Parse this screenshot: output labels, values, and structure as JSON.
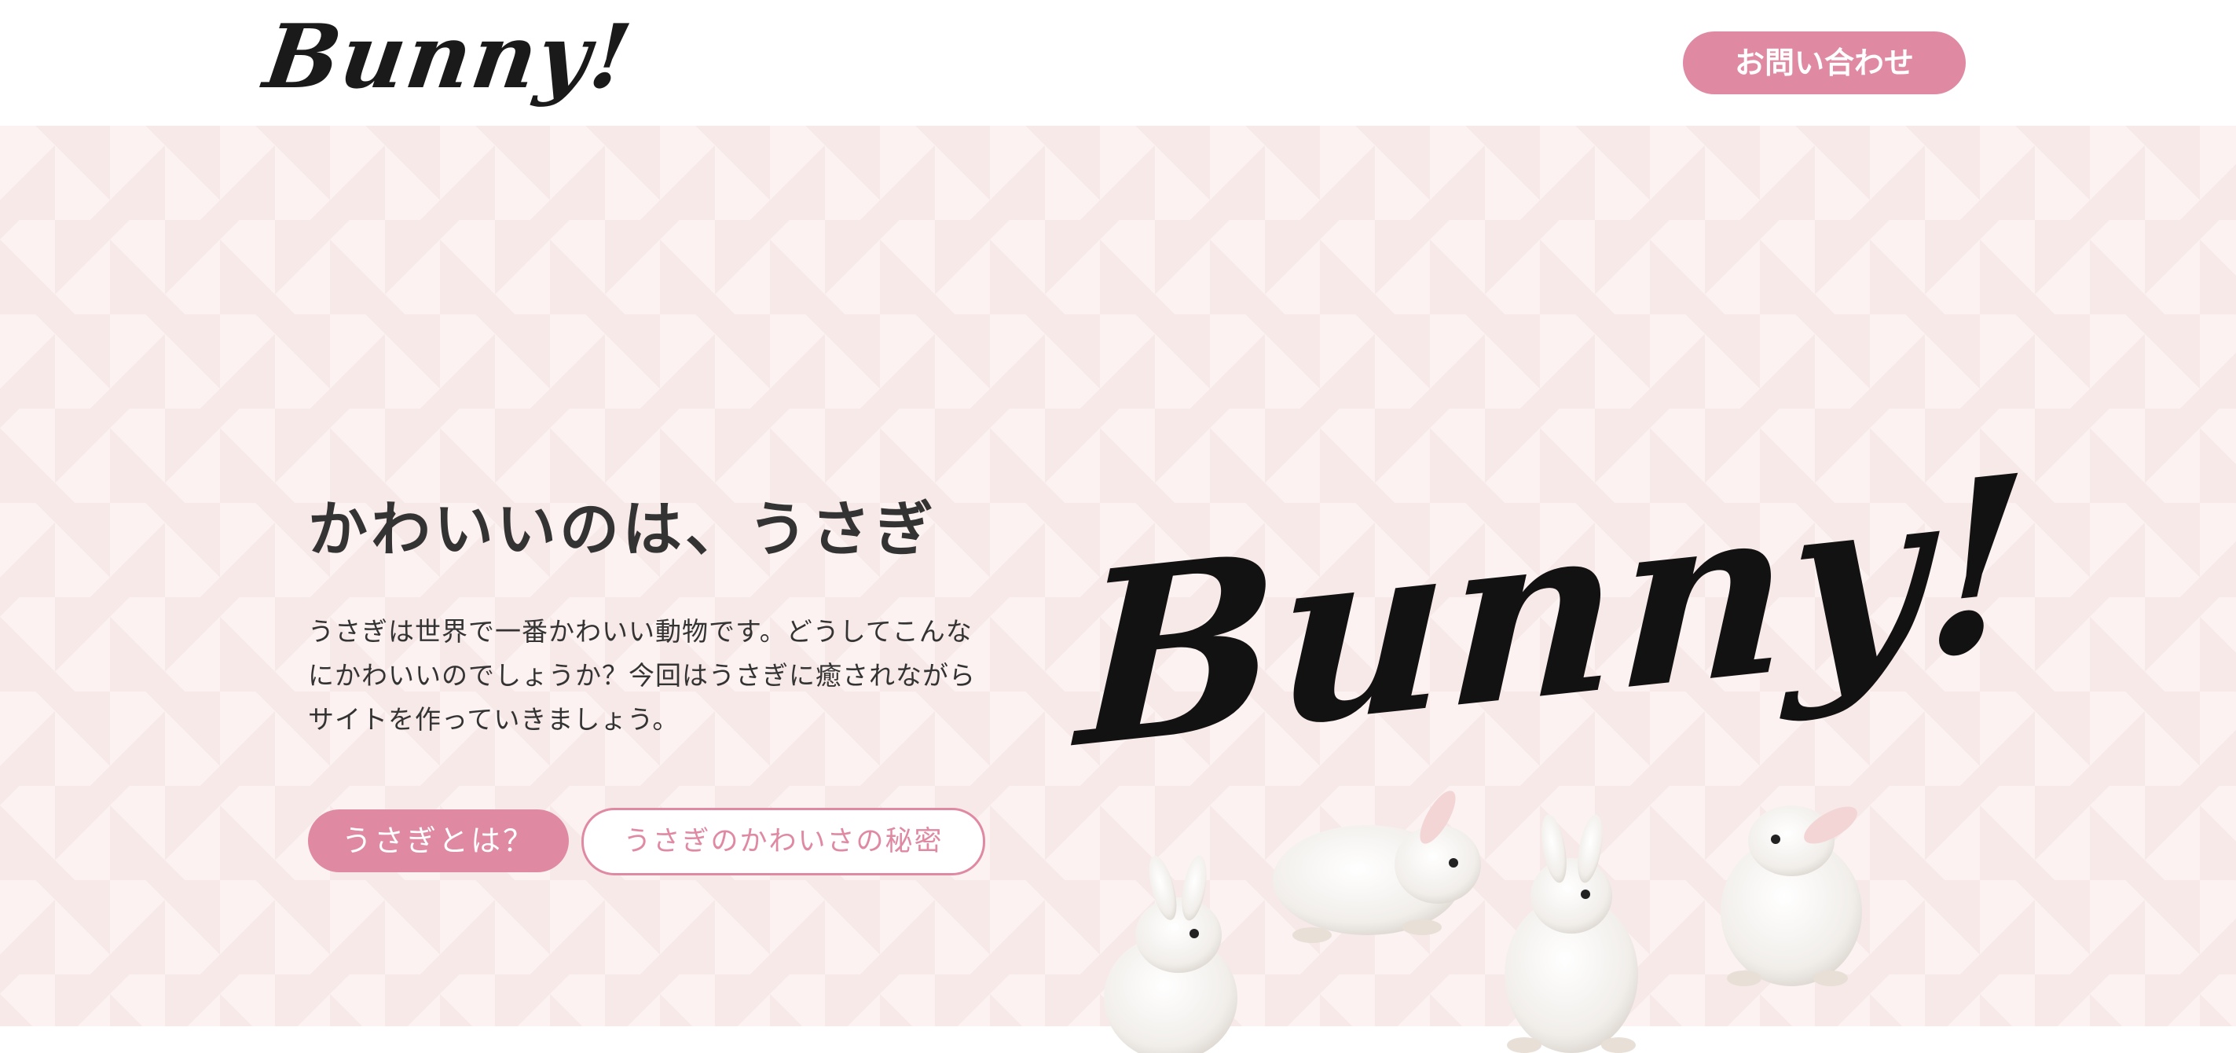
{
  "header": {
    "logo_text": "Bunny!",
    "contact_label": "お問い合わせ"
  },
  "hero": {
    "title": "かわいいのは、うさぎ",
    "description_lines": [
      "うさぎは世界で一番かわいい動物です。どうしてこんな",
      "にかわいいのでしょうか？今回はうさぎに癒されながら",
      "サイトを作っていきましょう。"
    ],
    "primary_button": "うさぎとは？",
    "secondary_button": "うさぎのかわいさの秘密",
    "art_logo_text": "Bunny!"
  },
  "colors": {
    "accent": "#df89a3",
    "hero_bg": "#fbf2f1",
    "text": "#333333"
  },
  "icons": {
    "hero_image": "white-rabbits-illustration"
  }
}
